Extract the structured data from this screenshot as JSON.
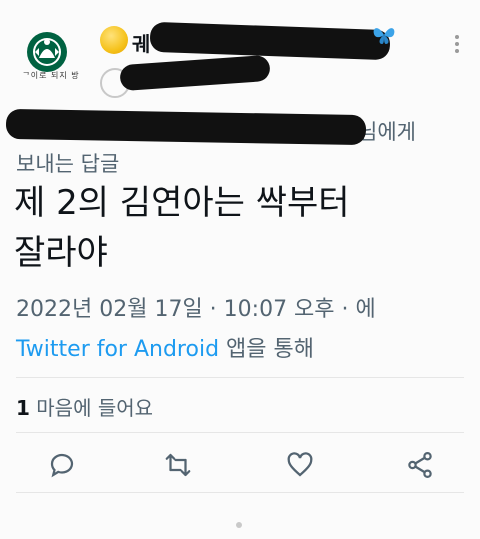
{
  "header": {
    "avatar_caption": "ᄀ이로 되지 방",
    "name_prefix": "궤",
    "more_label": "⋮"
  },
  "reply": {
    "label_tail": "님에게",
    "label_line2": "보내는 답글"
  },
  "tweet": {
    "line1": "제 2의 김연아는 싹부터",
    "line2": "잘라야"
  },
  "meta": {
    "timestamp": "2022년 02월 17일 · 10:07 오후 · 에",
    "source_link": "Twitter for Android",
    "source_suffix": " 앱을 통해"
  },
  "stats": {
    "likes_count": "1",
    "likes_label": " 마음에 들어요"
  },
  "actions": [
    "reply-icon",
    "retweet-icon",
    "like-icon",
    "share-icon"
  ],
  "colors": {
    "accent": "#1d9bf0",
    "muted": "#536471",
    "text": "#0f1419"
  }
}
